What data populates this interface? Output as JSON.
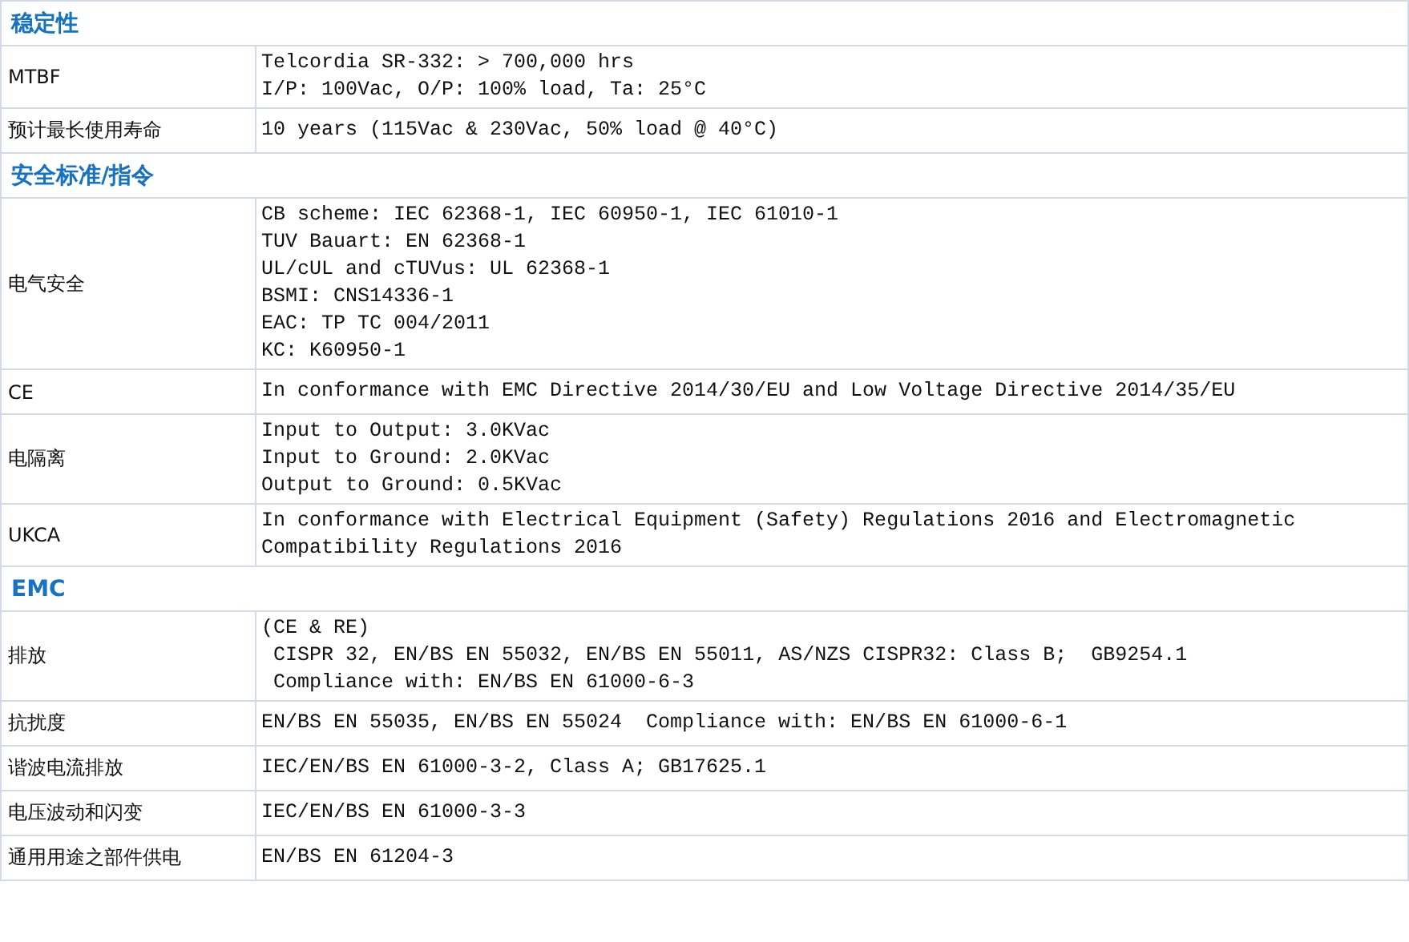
{
  "rows": [
    {
      "kind": "section",
      "title": "稳定性"
    },
    {
      "kind": "spec",
      "label": "MTBF",
      "lines": [
        "Telcordia SR-332: > 700,000 hrs",
        "I/P: 100Vac, O/P: 100% load, Ta: 25°C"
      ]
    },
    {
      "kind": "spec",
      "label": "预计最长使用寿命",
      "lines": [
        "10 years (115Vac & 230Vac, 50% load @ 40°C)"
      ]
    },
    {
      "kind": "section",
      "title": "安全标准/指令"
    },
    {
      "kind": "spec",
      "label": "电气安全",
      "lines": [
        "CB scheme: IEC 62368-1, IEC 60950-1, IEC 61010-1",
        "TUV Bauart: EN 62368-1",
        "UL/cUL and cTUVus: UL 62368-1",
        "BSMI: CNS14336-1",
        "EAC: TP TC 004/2011",
        "KC: K60950-1"
      ]
    },
    {
      "kind": "spec",
      "label": "CE",
      "lines": [
        "In conformance with EMC Directive 2014/30/EU and Low Voltage Directive 2014/35/EU"
      ]
    },
    {
      "kind": "spec",
      "label": "电隔离",
      "lines": [
        "Input to Output: 3.0KVac",
        "Input to Ground: 2.0KVac",
        "Output to Ground: 0.5KVac"
      ]
    },
    {
      "kind": "spec",
      "label": "UKCA",
      "lines": [
        "In conformance with Electrical Equipment (Safety) Regulations 2016 and Electromagnetic Compatibility Regulations 2016"
      ]
    },
    {
      "kind": "section",
      "title": "EMC"
    },
    {
      "kind": "spec",
      "label": "排放",
      "lines": [
        "(CE & RE)",
        " CISPR 32, EN/BS EN 55032, EN/BS EN 55011, AS/NZS CISPR32: Class B;  GB9254.1",
        " Compliance with: EN/BS EN 61000-6-3"
      ]
    },
    {
      "kind": "spec",
      "label": "抗扰度",
      "lines": [
        "EN/BS EN 55035, EN/BS EN 55024  Compliance with: EN/BS EN 61000-6-1"
      ]
    },
    {
      "kind": "spec",
      "label": "谐波电流排放",
      "lines": [
        "IEC/EN/BS EN 61000-3-2, Class A; GB17625.1"
      ]
    },
    {
      "kind": "spec",
      "label": "电压波动和闪变",
      "lines": [
        "IEC/EN/BS EN 61000-3-3"
      ]
    },
    {
      "kind": "spec",
      "label": "通用用途之部件供电",
      "lines": [
        "EN/BS EN 61204-3"
      ]
    }
  ]
}
